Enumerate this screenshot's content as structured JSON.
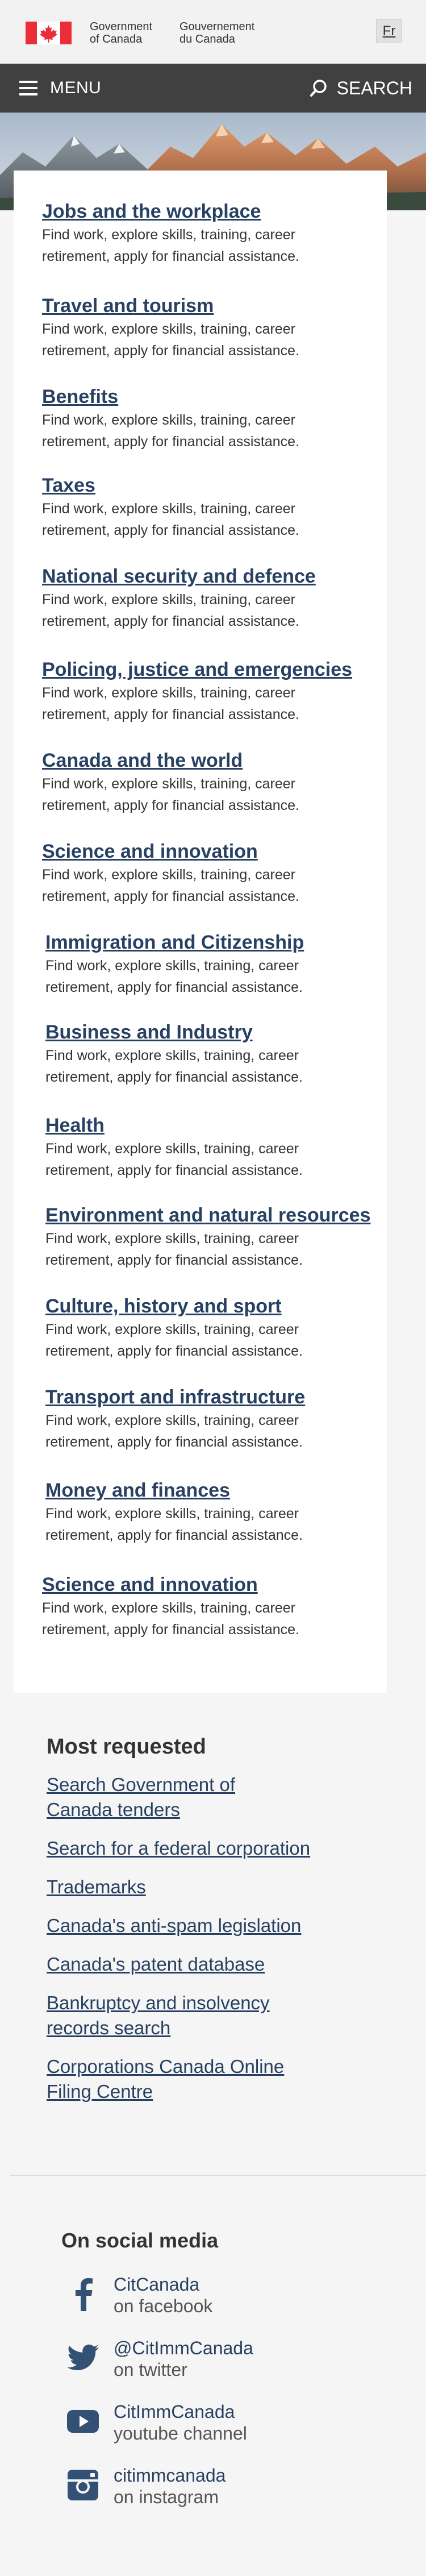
{
  "header": {
    "gov_en_line1": "Government",
    "gov_en_line2": "of Canada",
    "gov_fr_line1": "Gouvernement",
    "gov_fr_line2": "du Canada",
    "lang_toggle": "Fr"
  },
  "navbar": {
    "menu_label": "MENU",
    "search_label": "SEARCH"
  },
  "topics": [
    {
      "title": "Jobs and the workplace",
      "desc_line1": "Find work, explore skills, training, career",
      "desc_line2": "retirement, apply for financial assistance."
    },
    {
      "title": "Travel and tourism",
      "desc_line1": "Find work, explore skills, training, career",
      "desc_line2": "retirement, apply for financial assistance."
    },
    {
      "title": "Benefits",
      "desc_line1": "Find work, explore skills, training, career",
      "desc_line2": "retirement, apply for financial assistance."
    },
    {
      "title": "Taxes",
      "desc_line1": "Find work, explore skills, training, career",
      "desc_line2": "retirement, apply for financial assistance."
    },
    {
      "title": "National security and defence",
      "desc_line1": "Find work, explore skills, training, career",
      "desc_line2": "retirement, apply for financial assistance."
    },
    {
      "title": "Policing, justice and emergencies",
      "desc_line1": "Find work, explore skills, training, career",
      "desc_line2": "retirement, apply for financial assistance."
    },
    {
      "title": "Canada and the world",
      "desc_line1": "Find work, explore skills, training, career",
      "desc_line2": "retirement, apply for financial assistance."
    },
    {
      "title": "Science and innovation",
      "desc_line1": "Find work, explore skills, training, career",
      "desc_line2": "retirement, apply for financial assistance."
    },
    {
      "title": "Immigration and Citizenship",
      "desc_line1": "Find work, explore skills, training, career",
      "desc_line2": "retirement, apply for financial assistance."
    },
    {
      "title": "Business and Industry",
      "desc_line1": "Find work, explore skills, training, career",
      "desc_line2": "retirement, apply for financial assistance."
    },
    {
      "title": "Health",
      "desc_line1": "Find work, explore skills, training, career",
      "desc_line2": "retirement, apply for financial assistance."
    },
    {
      "title": "Environment and natural resources",
      "desc_line1": "Find work, explore skills, training, career",
      "desc_line2": "retirement, apply for financial assistance."
    },
    {
      "title": "Culture, history and sport",
      "desc_line1": "Find work, explore skills, training, career",
      "desc_line2": "retirement, apply for financial assistance."
    },
    {
      "title": "Transport and infrastructure",
      "desc_line1": "Find work, explore skills, training, career",
      "desc_line2": "retirement, apply for financial assistance."
    },
    {
      "title": "Money and finances",
      "desc_line1": "Find work, explore skills, training, career",
      "desc_line2": "retirement, apply for financial assistance."
    },
    {
      "title": "Science and innovation",
      "desc_line1": "Find work, explore skills, training, career",
      "desc_line2": "retirement, apply for financial assistance."
    }
  ],
  "most_requested": {
    "heading": "Most requested",
    "links": [
      {
        "line1": "Search Government of",
        "line2": "Canada tenders"
      },
      {
        "line1": "Search for a federal corporation",
        "line2": ""
      },
      {
        "line1": "Trademarks",
        "line2": ""
      },
      {
        "line1": "Canada's anti-spam legislation",
        "line2": ""
      },
      {
        "line1": "Canada's patent database",
        "line2": ""
      },
      {
        "line1": "Bankruptcy and insolvency",
        "line2": "records search"
      },
      {
        "line1": "Corporations Canada Online",
        "line2": "Filing Centre"
      }
    ]
  },
  "social": {
    "heading": "On social media",
    "items": [
      {
        "handle": "CitCanada",
        "sub": "on facebook",
        "icon": "facebook-icon"
      },
      {
        "handle": "@CitImmCanada",
        "sub": "on twitter",
        "icon": "twitter-icon"
      },
      {
        "handle": "CitImmCanada",
        "sub": "youtube channel",
        "icon": "youtube-icon"
      },
      {
        "handle": "citimmcanada",
        "sub": "on instagram",
        "icon": "instagram-icon"
      }
    ]
  },
  "colors": {
    "link": "#284162",
    "navbar": "#404040",
    "flag_red": "#eb2d37",
    "icon_blue": "#335075"
  }
}
